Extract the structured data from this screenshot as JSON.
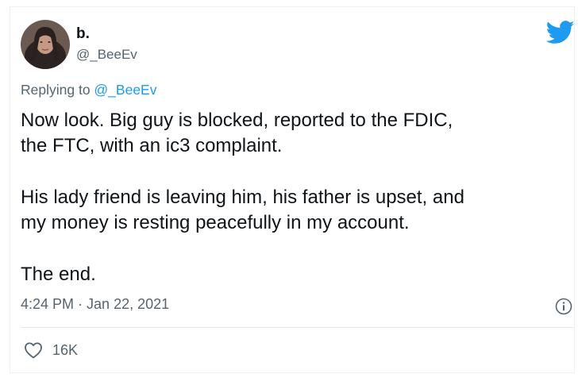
{
  "user": {
    "display_name": "b.",
    "handle": "@_BeeEv"
  },
  "reply": {
    "prefix": "Replying to ",
    "handle": "@_BeeEv"
  },
  "tweet": {
    "line1": "Now look. Big guy is blocked, reported to the FDIC,",
    "line2": "the FTC, with an ic3 complaint.",
    "line3": "His lady friend is leaving him, his father is upset, and",
    "line4": "my money is resting peacefully in my account.",
    "line5": "The end."
  },
  "meta": {
    "time": "4:24 PM",
    "separator": " · ",
    "date": "Jan 22, 2021"
  },
  "stats": {
    "likes": "16K"
  },
  "icons": {
    "brand": "twitter-bird-icon",
    "info": "info-icon",
    "like": "heart-icon"
  },
  "colors": {
    "brand_blue": "#1d9bf0",
    "text": "#0f1419",
    "secondary": "#536471"
  }
}
